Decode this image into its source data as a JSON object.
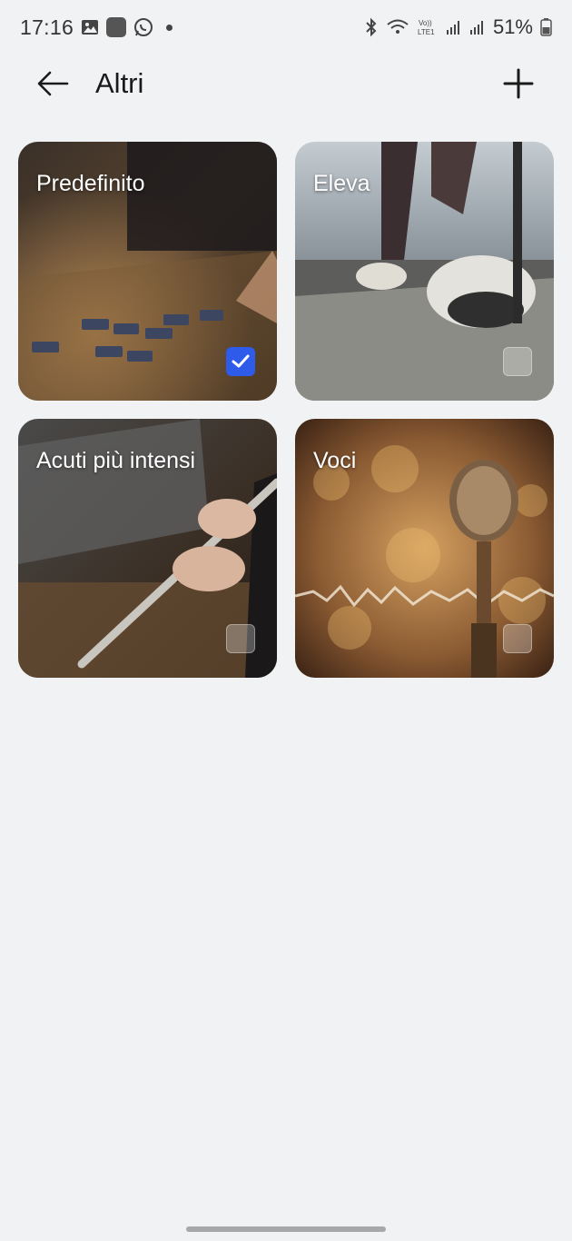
{
  "status_bar": {
    "time": "17:16",
    "network": "Vo)) LTE1",
    "battery_text": "51%"
  },
  "header": {
    "title": "Altri",
    "back_icon": "arrow-left-icon",
    "add_icon": "plus-icon"
  },
  "presets": [
    {
      "label": "Predefinito",
      "checked": true,
      "image": "mixing-console"
    },
    {
      "label": "Eleva",
      "checked": false,
      "image": "treadmill-running"
    },
    {
      "label": "Acuti più intensi",
      "checked": false,
      "image": "flute-player"
    },
    {
      "label": "Voci",
      "checked": false,
      "image": "vintage-microphone"
    }
  ],
  "colors": {
    "accent": "#2f5bea",
    "background": "#f1f2f4"
  }
}
